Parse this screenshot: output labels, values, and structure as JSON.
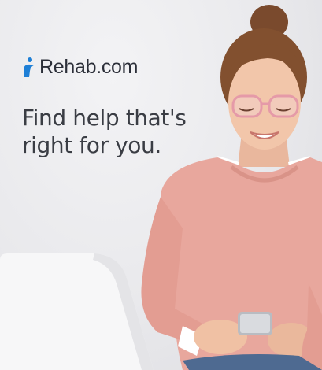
{
  "brand": {
    "logo_icon": "person-figure-icon",
    "name": "Rehab.com",
    "accent_color": "#1e7fd6",
    "text_color": "#2c2f39"
  },
  "headline": "Find help that's right for you.",
  "photo": {
    "icon": "woman-with-phone-photo",
    "sweater_color": "#e8a79d",
    "background_color": "#ebebed"
  }
}
